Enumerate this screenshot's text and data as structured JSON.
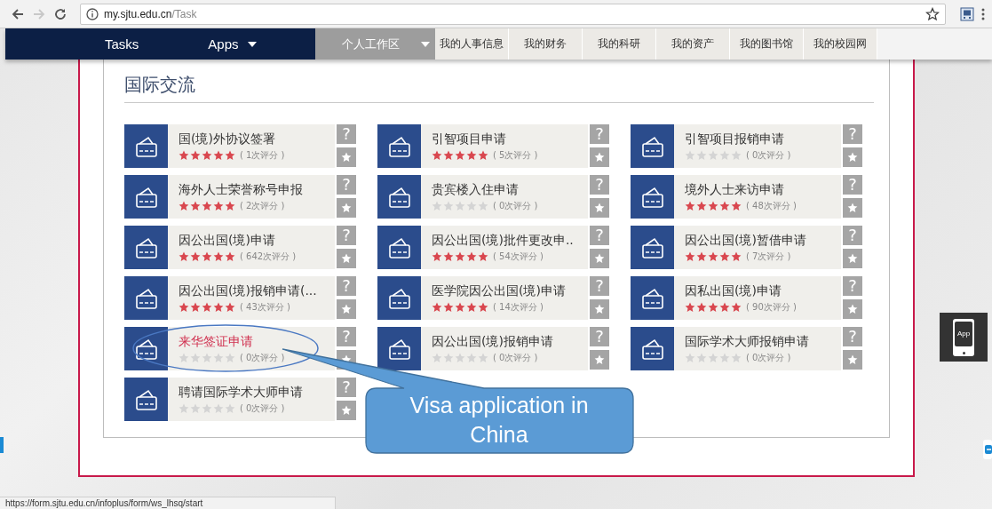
{
  "browser": {
    "url_host": "my.sjtu.edu.cn",
    "url_path": "/Task",
    "forward_disabled": true
  },
  "nav": {
    "left": [
      {
        "label": "Tasks",
        "dropdown": false
      },
      {
        "label": "Apps",
        "dropdown": true
      }
    ],
    "workspace": {
      "label": "个人工作区",
      "dropdown": true
    },
    "tabs": [
      {
        "label": "我的人事信息"
      },
      {
        "label": "我的财务"
      },
      {
        "label": "我的科研"
      },
      {
        "label": "我的资产"
      },
      {
        "label": "我的图书馆"
      },
      {
        "label": "我的校园网"
      }
    ]
  },
  "section": {
    "title": "国际交流"
  },
  "tiles": [
    {
      "title": "国(境)外协议签署",
      "stars": 5,
      "count": "( 1次评分 )",
      "help": "?",
      "hovered": false
    },
    {
      "title": "引智项目申请",
      "stars": 5,
      "count": "( 5次评分 )",
      "help": "?",
      "hovered": false
    },
    {
      "title": "引智项目报销申请",
      "stars": 0,
      "count": "( 0次评分 )",
      "help": "?",
      "hovered": false
    },
    {
      "title": "海外人士荣誉称号申报",
      "stars": 5,
      "count": "( 2次评分 )",
      "help": "?",
      "hovered": false
    },
    {
      "title": "贵宾楼入住申请",
      "stars": 0,
      "count": "( 0次评分 )",
      "help": "?",
      "hovered": false
    },
    {
      "title": "境外人士来访申请",
      "stars": 5,
      "count": "( 48次评分 )",
      "help": "?",
      "hovered": false
    },
    {
      "title": "因公出国(境)申请",
      "stars": 5,
      "count": "( 642次评分 )",
      "help": "?",
      "hovered": false
    },
    {
      "title": "因公出国(境)批件更改申..",
      "stars": 5,
      "count": "( 54次评分 )",
      "help": "?",
      "hovered": false
    },
    {
      "title": "因公出国(境)暂借申请",
      "stars": 5,
      "count": "( 7次评分 )",
      "help": "?",
      "hovered": false
    },
    {
      "title": "因公出国(境)报销申请(...",
      "stars": 5,
      "count": "( 43次评分 )",
      "help": "?",
      "hovered": false
    },
    {
      "title": "医学院因公出国(境)申请",
      "stars": 5,
      "count": "( 14次评分 )",
      "help": "?",
      "hovered": false
    },
    {
      "title": "因私出国(境)申请",
      "stars": 5,
      "count": "( 90次评分 )",
      "help": "?",
      "hovered": false
    },
    {
      "title": "来华签证申请",
      "stars": 0,
      "count": "( 0次评分 )",
      "help": "?",
      "hovered": true
    },
    {
      "title": "因公出国(境)报销申请",
      "stars": 0,
      "count": "( 0次评分 )",
      "help": "?",
      "hovered": false
    },
    {
      "title": "国际学术大师报销申请",
      "stars": 0,
      "count": "( 0次评分 )",
      "help": "?",
      "hovered": false
    },
    {
      "title": "聘请国际学术大师申请",
      "stars": 0,
      "count": "( 0次评分 )",
      "help": "?",
      "hovered": false
    }
  ],
  "callout": {
    "text": "Visa application in China"
  },
  "app_button": {
    "label": "App"
  },
  "status_bar": {
    "url": "https://form.sjtu.edu.cn/infoplus/form/ws_lhsq/start"
  }
}
